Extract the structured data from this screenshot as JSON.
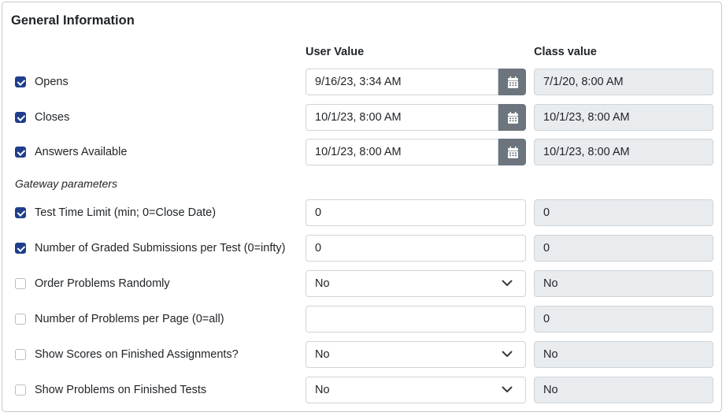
{
  "card": {
    "title": "General Information",
    "user_value_header": "User Value",
    "class_value_header": "Class value",
    "gateway_label": "Gateway parameters"
  },
  "rows": [
    {
      "label": "Opens",
      "checked": true,
      "kind": "datetime",
      "user_value": "9/16/23, 3:34 AM",
      "class_value": "7/1/20, 8:00 AM"
    },
    {
      "label": "Closes",
      "checked": true,
      "kind": "datetime",
      "user_value": "10/1/23, 8:00 AM",
      "class_value": "10/1/23, 8:00 AM"
    },
    {
      "label": "Answers Available",
      "checked": true,
      "kind": "datetime",
      "user_value": "10/1/23, 8:00 AM",
      "class_value": "10/1/23, 8:00 AM"
    },
    {
      "label": "Test Time Limit (min; 0=Close Date)",
      "checked": true,
      "kind": "text",
      "user_value": "0",
      "class_value": "0"
    },
    {
      "label": "Number of Graded Submissions per Test (0=infty)",
      "checked": true,
      "kind": "text",
      "user_value": "0",
      "class_value": "0"
    },
    {
      "label": "Order Problems Randomly",
      "checked": false,
      "kind": "select",
      "user_value": "No",
      "class_value": "No"
    },
    {
      "label": "Number of Problems per Page (0=all)",
      "checked": false,
      "kind": "text",
      "user_value": "",
      "class_value": "0"
    },
    {
      "label": "Show Scores on Finished Assignments?",
      "checked": false,
      "kind": "select",
      "user_value": "No",
      "class_value": "No"
    },
    {
      "label": "Show Problems on Finished Tests",
      "checked": false,
      "kind": "select",
      "user_value": "No",
      "class_value": "No"
    }
  ],
  "icons": {
    "calendar": "calendar-icon",
    "dropdown": "chevron-down-icon"
  },
  "colors": {
    "checkbox_checked": "#1f3e8c",
    "calendar_button": "#6c757d",
    "readonly_bg": "#e9ecef"
  }
}
